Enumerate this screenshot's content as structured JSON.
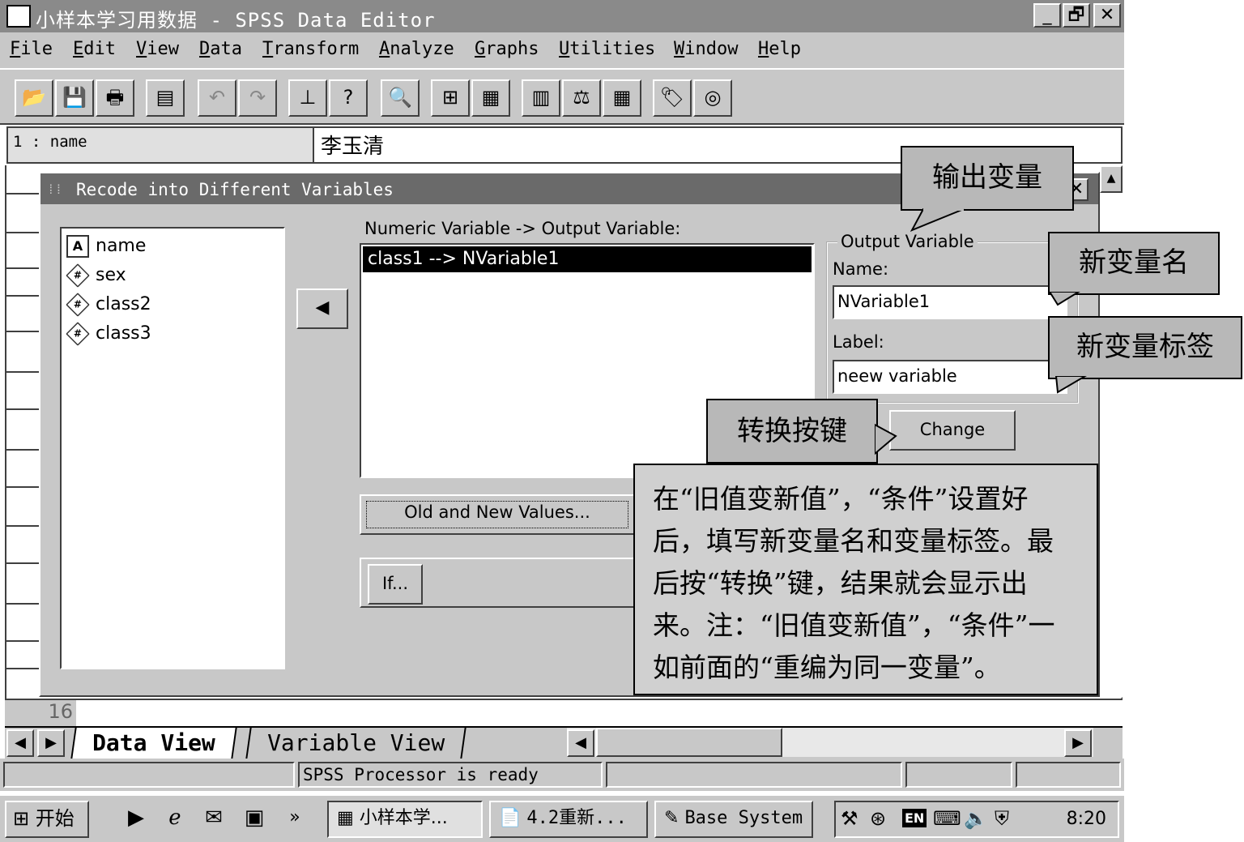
{
  "app": {
    "title": "小样本学习用数据 - SPSS Data Editor",
    "minimize_glyph": "_",
    "maximize_glyph": "🗗",
    "close_glyph": "✕"
  },
  "menu": [
    "File",
    "Edit",
    "View",
    "Data",
    "Transform",
    "Analyze",
    "Graphs",
    "Utilities",
    "Window",
    "Help"
  ],
  "toolbar_icons": [
    "open-icon",
    "save-icon",
    "print-icon",
    "dialog-recall-icon",
    "undo-icon",
    "redo-icon",
    "goto-chart-icon",
    "goto-case-icon",
    "find-icon",
    "insert-case-icon",
    "insert-variable-icon",
    "split-file-icon",
    "weight-cases-icon",
    "select-cases-icon",
    "value-labels-icon",
    "use-sets-icon"
  ],
  "cell_editor": {
    "ref": "1 : name",
    "value": "李玉清"
  },
  "dialog": {
    "title": "Recode into Different Variables",
    "close_glyph": "✕",
    "source_variables": [
      {
        "name": "name",
        "type_icon": "A"
      },
      {
        "name": "sex",
        "type_icon": "#"
      },
      {
        "name": "class2",
        "type_icon": "#"
      },
      {
        "name": "class3",
        "type_icon": "#"
      }
    ],
    "move_glyph": "◀",
    "mapping_label": "Numeric Variable -> Output Variable:",
    "mapping_selected": "class1 --> NVariable1",
    "old_new_button": "Old and New Values...",
    "if_button": "If...",
    "output_variable_legend": "Output Variable",
    "name_label": "Name:",
    "name_value": "NVariable1",
    "label_label": "Label:",
    "label_value": "neew variable",
    "change_button": "Change"
  },
  "callouts": {
    "output_variable": "输出变量",
    "new_var_name": "新变量名",
    "new_var_label": "新变量标签",
    "convert_button": "转换按键",
    "note": "在“旧值变新值”，“条件”设置好后，填写新变量名和变量标签。最后按“转换”键，结果就会显示出来。注：“旧值变新值”，“条件”一如前面的“重编为同一变量”。"
  },
  "grid": {
    "visible_row_number": "16"
  },
  "sheet_tabs": {
    "data_view": "Data View",
    "variable_view": "Variable View",
    "first_glyph": "◀",
    "next_glyph": "▶",
    "scroll_left_glyph": "◀",
    "scroll_right_glyph": "▶"
  },
  "status": {
    "processor": "SPSS Processor  is ready"
  },
  "taskbar": {
    "start_label": "开始",
    "quick_launch_more": "»",
    "tasks": [
      "小样本学...",
      "4.2重新...",
      "Base System"
    ],
    "tray_lang": "EN",
    "clock": "8:20"
  },
  "colors": {
    "chrome": "#c8c8c8",
    "titlebar_inactive": "#8a8a8a",
    "dialog_titlebar": "#6a6a6a",
    "selection": "#000000",
    "callout_fill": "#b8b8b8"
  }
}
